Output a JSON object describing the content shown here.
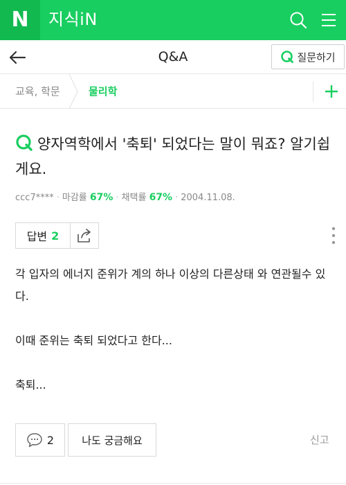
{
  "header": {
    "logo_letter": "N",
    "app_title": "지식iN",
    "brand_color": "#19ce60",
    "icons": [
      "search-icon",
      "menu-icon"
    ]
  },
  "nav": {
    "title": "Q&A",
    "ask_button_label": "질문하기",
    "icons": [
      "back-arrow-icon",
      "q-icon"
    ]
  },
  "breadcrumb": {
    "items": [
      "교육, 학문",
      "물리학"
    ],
    "icons": [
      "plus-icon"
    ]
  },
  "question": {
    "title": "양자역학에서 '축퇴' 되었다는 말이 뭐죠? 알기쉽게요.",
    "author": "ccc7****",
    "deadline_label": "마감률",
    "deadline_rate": "67%",
    "adopt_label": "채택률",
    "adopt_rate": "67%",
    "date": "2004.11.08."
  },
  "actions": {
    "answer_label": "답변",
    "answer_count": "2",
    "icons": [
      "share-icon",
      "more-vertical-icon"
    ]
  },
  "body": {
    "line1": "각 입자의 에너지 준위가 계의 하나 이상의 다른상태 와 연관될수 있다.",
    "line2": "이때 준위는 축퇴 되었다고 한다...",
    "line3": "축퇴..."
  },
  "bottom": {
    "comment_count": "2",
    "curious_label": "나도 궁금해요",
    "report_label": "신고",
    "icons": [
      "comment-icon"
    ]
  }
}
